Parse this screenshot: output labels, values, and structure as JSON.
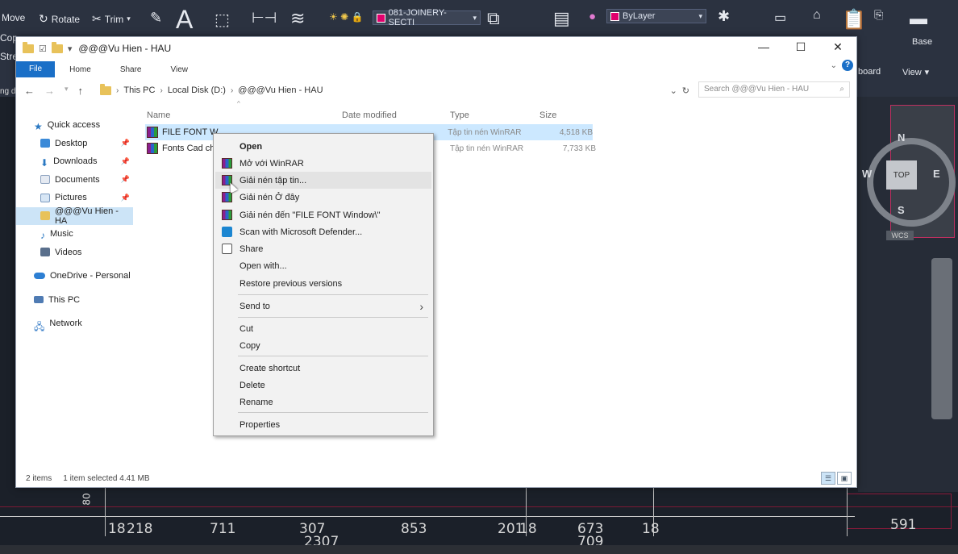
{
  "cad": {
    "ribbon_tools": {
      "move": "Move",
      "rotate": "Rotate",
      "trim": "Trim",
      "stretch": "Stre",
      "copy": "Cop"
    },
    "layer_name": "081-JOINERY-SECTI",
    "color_combo": "ByLayer",
    "right_panel": {
      "base": "Base",
      "clipboard": "board",
      "view": "View",
      "view_arrow": "▾"
    },
    "viewcube": {
      "n": "N",
      "s": "S",
      "e": "E",
      "w": "W",
      "top": "TOP",
      "wcs": "WCS"
    },
    "dimensions": [
      "18",
      "218",
      "711",
      "307",
      "853",
      "201",
      "18",
      "673",
      "18",
      "591",
      "2307",
      "709",
      "80"
    ],
    "canvas_side_text": "ng d"
  },
  "window": {
    "title": "@@@Vu Hien - HAU",
    "qat_chevron": "▾",
    "controls": {
      "minimize": "—",
      "maximize": "☐",
      "close": "✕"
    },
    "ribbon_tabs": {
      "file": "File",
      "home": "Home",
      "share": "Share",
      "view": "View"
    },
    "help": "?"
  },
  "address": {
    "crumbs": [
      "This PC",
      "Local Disk (D:)",
      "@@@Vu Hien - HAU"
    ],
    "sep": "›",
    "search_placeholder": "Search @@@Vu Hien - HAU"
  },
  "navpane": {
    "quick_access": "Quick access",
    "items": [
      {
        "label": "Desktop",
        "pinned": true
      },
      {
        "label": "Downloads",
        "pinned": true
      },
      {
        "label": "Documents",
        "pinned": true
      },
      {
        "label": "Pictures",
        "pinned": true
      },
      {
        "label": "@@@Vu Hien - HA",
        "pinned": false
      },
      {
        "label": "Music",
        "pinned": false
      },
      {
        "label": "Videos",
        "pinned": false
      }
    ],
    "onedrive": "OneDrive - Personal",
    "this_pc": "This PC",
    "network": "Network"
  },
  "files": {
    "columns": {
      "name": "Name",
      "date": "Date modified",
      "type": "Type",
      "size": "Size"
    },
    "rows": [
      {
        "name": "FILE FONT W",
        "type": "Tập tin nén WinRAR",
        "size": "4,518 KB",
        "selected": true
      },
      {
        "name": "Fonts Cad ch",
        "type": "Tập tin nén WinRAR",
        "size": "7,733 KB",
        "selected": false
      }
    ]
  },
  "status": {
    "count": "2 items",
    "selection": "1 item selected  4.41 MB"
  },
  "context_menu": {
    "open": "Open",
    "open_winrar": "Mở với WinRAR",
    "extract_files": "Giải nén tập tin...",
    "extract_here": "Giải nén Ở đây",
    "extract_to": "Giải nén đến \"FILE FONT Window\\\"",
    "scan": "Scan with Microsoft Defender...",
    "share": "Share",
    "open_with": "Open with...",
    "restore": "Restore previous versions",
    "send_to": "Send to",
    "cut": "Cut",
    "copy": "Copy",
    "create_shortcut": "Create shortcut",
    "delete": "Delete",
    "rename": "Rename",
    "properties": "Properties"
  }
}
